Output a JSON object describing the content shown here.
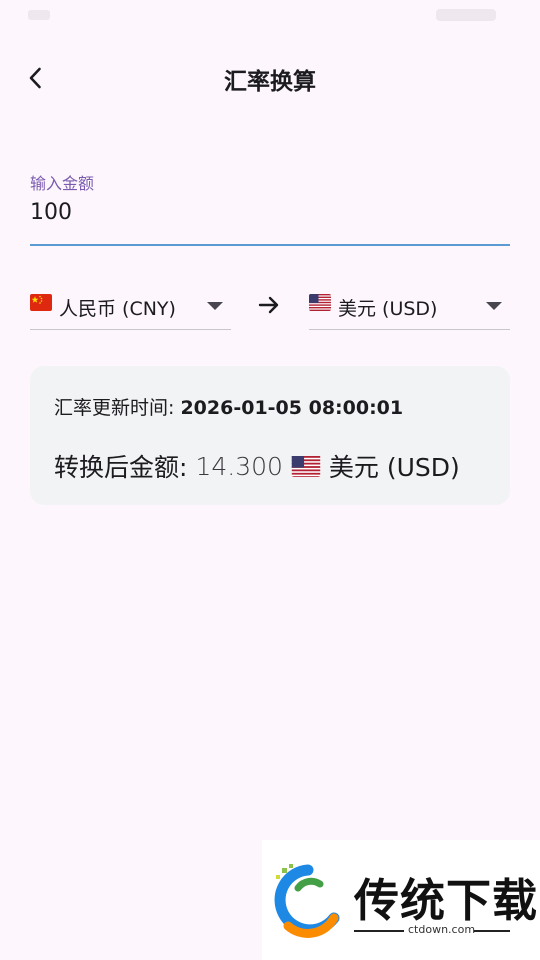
{
  "app_bar": {
    "title": "汇率换算",
    "back_icon": "arrow-back-icon"
  },
  "amount_field": {
    "label": "输入金额",
    "value": "100"
  },
  "from_currency": {
    "flag": "china-flag-icon",
    "label": "人民币 (CNY)"
  },
  "to_currency": {
    "flag": "usa-flag-icon",
    "label": "美元 (USD)"
  },
  "swap_icon": "arrow-forward-icon",
  "result_card": {
    "update_label": "汇率更新时间:",
    "update_time": "2026-01-05 08:00:01",
    "result_label": "转换后金额:",
    "result_value": "14.300",
    "result_currency": "美元 (USD)"
  },
  "watermark": {
    "title": "传统下载",
    "url": "ctdown.com"
  },
  "colors": {
    "background": "#fdf7fd",
    "label_purple": "#7a5bb0",
    "underline_blue": "#5b9bd1",
    "card_bg": "#f2f3f4"
  }
}
